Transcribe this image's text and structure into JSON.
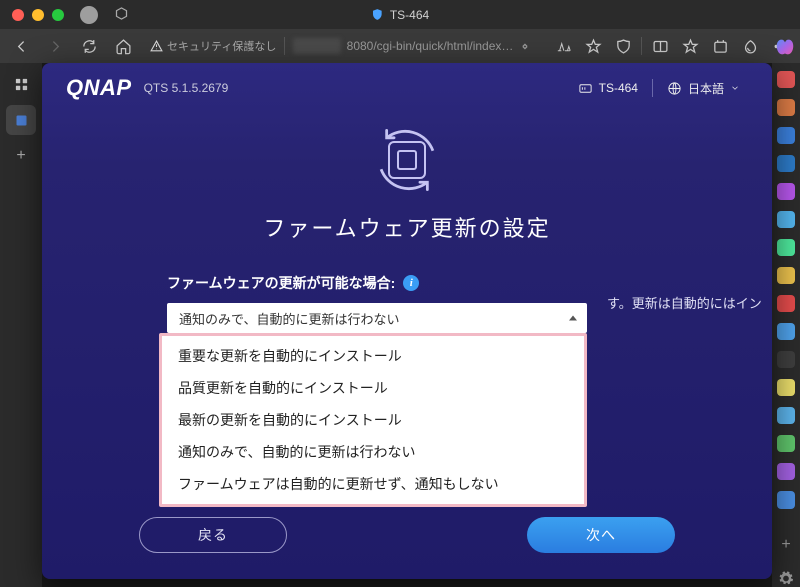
{
  "window": {
    "title": "TS-464"
  },
  "browser": {
    "security_label": "セキュリティ保護なし",
    "url": "8080/cgi-bin/quick/html/index.html#ad..."
  },
  "qnap": {
    "logo": "QNAP",
    "version": "QTS 5.1.5.2679",
    "device": "TS-464",
    "language": "日本語",
    "page_title": "ファームウェア更新の設定",
    "form": {
      "label": "ファームウェアの更新が可能な場合:",
      "selected": "通知のみで、自動的に更新は行わない",
      "options": [
        "重要な更新を自動的にインストール",
        "品質更新を自動的にインストール",
        "最新の更新を自動的にインストール",
        "通知のみで、自動的に更新は行わない",
        "ファームウェアは自動的に更新せず、通知もしない"
      ],
      "hint_fragment": "す。更新は自動的にはイン"
    },
    "buttons": {
      "back": "戻る",
      "next": "次へ"
    }
  },
  "ext_colors": [
    "#e05555",
    "#d97a45",
    "#3a7ed9",
    "#2c79c5",
    "#b455e8",
    "#53b4ec",
    "#4de69b",
    "#e8bf4c",
    "#e24b4b",
    "#4ea0e8",
    "#3e3e3e",
    "#e8dc6a",
    "#5bb2e8",
    "#5ec26a",
    "#a160e0",
    "#4a8de0"
  ]
}
